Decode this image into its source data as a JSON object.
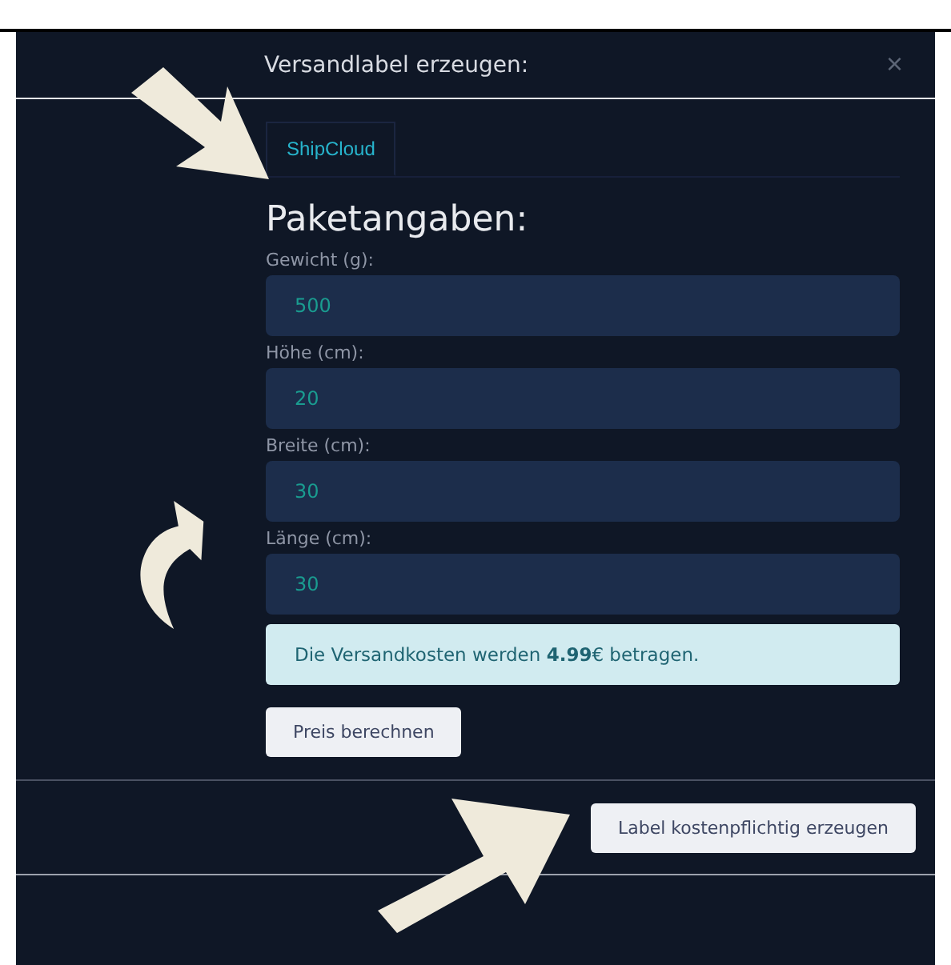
{
  "dialog": {
    "title": "Versandlabel erzeugen:",
    "close": "×"
  },
  "tabs": [
    {
      "label": "ShipCloud",
      "selected": true
    }
  ],
  "section_title": "Paketangaben:",
  "fields": [
    {
      "label": "Gewicht (g):",
      "value": "500"
    },
    {
      "label": "Höhe (cm):",
      "value": "20"
    },
    {
      "label": "Breite (cm):",
      "value": "30"
    },
    {
      "label": "Länge (cm):",
      "value": "30"
    }
  ],
  "notice": "Die Versandkosten werden **4.99**€ betragen.",
  "calculate_button": "Preis berechnen",
  "footer_button": "Label kostenpflichtig erzeugen"
}
